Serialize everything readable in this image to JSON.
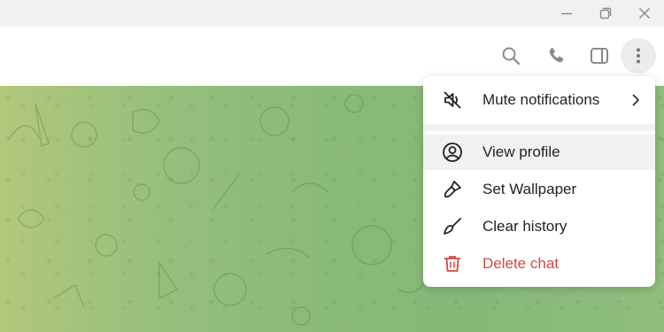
{
  "window": {
    "controls": [
      "minimize-icon",
      "restore-icon",
      "close-icon"
    ]
  },
  "header": {
    "icons": [
      "search-icon",
      "phone-icon",
      "sidebar-toggle-icon",
      "more-vertical-icon"
    ]
  },
  "menu": {
    "items": [
      {
        "label": "Mute notifications",
        "icon": "bell-muted-icon",
        "has_submenu": true
      },
      {
        "label": "View profile",
        "icon": "user-circle-icon",
        "highlighted": true
      },
      {
        "label": "Set Wallpaper",
        "icon": "brush-icon"
      },
      {
        "label": "Clear history",
        "icon": "broom-icon"
      },
      {
        "label": "Delete chat",
        "icon": "trash-icon",
        "color": "#d14a43"
      }
    ]
  },
  "colors": {
    "danger": "#d14a43",
    "icon": "#8a8a8a",
    "chat_background": "#8bba7a"
  }
}
